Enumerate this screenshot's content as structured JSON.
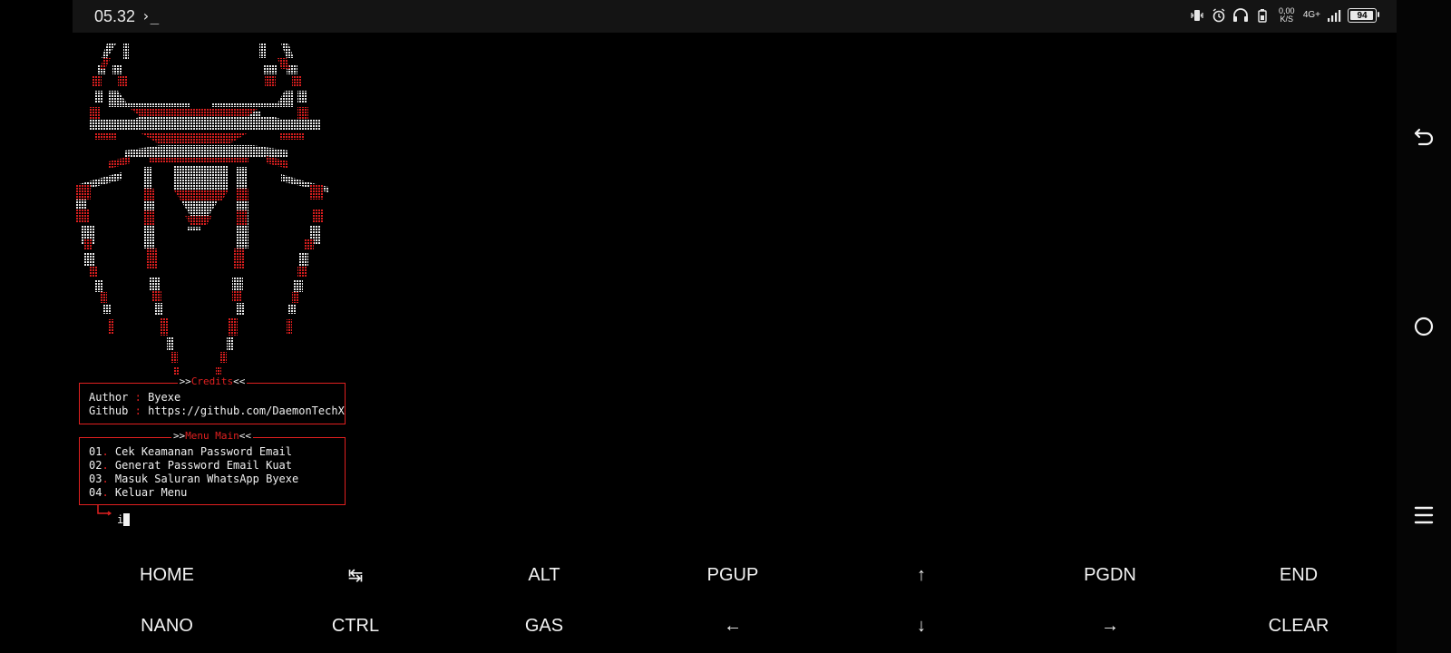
{
  "status_bar": {
    "time": "05.32",
    "prompt_glyph": "›_",
    "net_speed_value": "0,00",
    "net_speed_unit": "K/S",
    "network_type": "4G+",
    "battery": "94"
  },
  "credits": {
    "title_prefix": ">>",
    "title": "Credits",
    "title_suffix": "<<",
    "author_label": "Author",
    "author_value": "Byexe",
    "github_label": "Github",
    "github_value": "https://github.com/DaemonTechX",
    "separator": ":"
  },
  "menu": {
    "title_prefix": ">>",
    "title": "Menu Main",
    "title_suffix": "<<",
    "items": [
      {
        "num": "01",
        "label": "Cek Keamanan Password Email"
      },
      {
        "num": "02",
        "label": "Generat Password Email Kuat"
      },
      {
        "num": "03",
        "label": "Masuk Saluran WhatsApp Byexe"
      },
      {
        "num": "04",
        "label": "Keluar Menu"
      }
    ]
  },
  "prompt": {
    "input_value": "i"
  },
  "extra_keys": {
    "row1": [
      "HOME",
      "↹",
      "ALT",
      "PGUP",
      "↑",
      "PGDN",
      "END"
    ],
    "row2": [
      "NANO",
      "CTRL",
      "GAS",
      "←",
      "↓",
      "→",
      "CLEAR"
    ]
  },
  "icons": {
    "back": "back-icon",
    "home": "home-circle-icon",
    "menu": "menu-icon"
  },
  "colors": {
    "accent_red": "#e02020",
    "text": "#f0f0f0",
    "background": "#000000"
  }
}
